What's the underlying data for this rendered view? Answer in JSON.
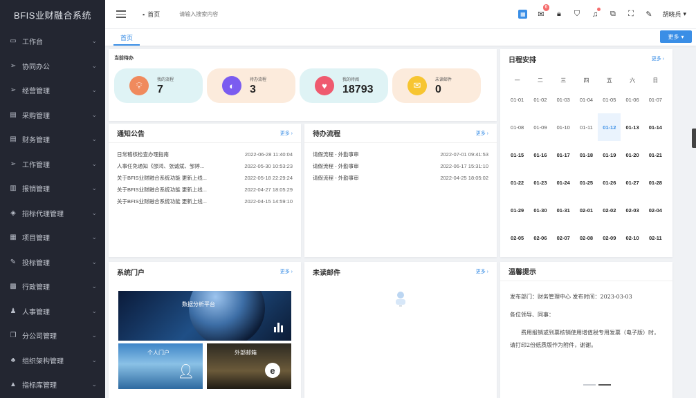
{
  "app": {
    "title": "BFIS业财融合系统"
  },
  "sidebar": {
    "items": [
      {
        "label": "工作台",
        "icon": "monitor-icon"
      },
      {
        "label": "协同办公",
        "icon": "send-icon"
      },
      {
        "label": "经营管理",
        "icon": "send-icon"
      },
      {
        "label": "采购管理",
        "icon": "document-icon"
      },
      {
        "label": "财务管理",
        "icon": "document-icon"
      },
      {
        "label": "工作管理",
        "icon": "send-icon"
      },
      {
        "label": "报销管理",
        "icon": "clipboard-icon"
      },
      {
        "label": "招标代理管理",
        "icon": "eye-icon"
      },
      {
        "label": "项目管理",
        "icon": "grid-icon"
      },
      {
        "label": "投标管理",
        "icon": "edit-icon"
      },
      {
        "label": "行政管理",
        "icon": "building-icon"
      },
      {
        "label": "人事管理",
        "icon": "user-icon"
      },
      {
        "label": "分公司管理",
        "icon": "copy-icon"
      },
      {
        "label": "组织架构管理",
        "icon": "org-icon"
      },
      {
        "label": "指标库管理",
        "icon": "warning-icon"
      }
    ]
  },
  "header": {
    "breadcrumb": "首页",
    "search_placeholder": "请输入搜索内容",
    "notification_badge": "6",
    "user": "胡晓兵"
  },
  "tabs": {
    "active": "首页",
    "more": "更多"
  },
  "todo": {
    "title": "当前待办",
    "stats": [
      {
        "label": "我的流程",
        "value": "7",
        "icon": "bulb-icon",
        "color": "#f08a5d",
        "bg": "#dff3f5"
      },
      {
        "label": "待办流程",
        "value": "3",
        "icon": "compass-icon",
        "color": "#7b5cf0",
        "bg": "#fcebdc"
      },
      {
        "label": "我的待阅",
        "value": "18793",
        "icon": "heart-icon",
        "color": "#ef5a6f",
        "bg": "#dff3f5"
      },
      {
        "label": "未读邮件",
        "value": "0",
        "icon": "mail-icon",
        "color": "#f7c531",
        "bg": "#fcebdc"
      }
    ]
  },
  "notice": {
    "title": "通知公告",
    "more": "更多 ›",
    "items": [
      {
        "text": "日常稽核检查办理指南",
        "date": "2022-06-28 11:40:04"
      },
      {
        "text": "人事任免通知《邵鸿、张诚斌、邹婷...",
        "date": "2022-05-30 10:53:23"
      },
      {
        "text": "关于BFIS业财融合系统功能 更新上线...",
        "date": "2022-05-18 22:29:24"
      },
      {
        "text": "关于BFIS业财融合系统功能 更新上线...",
        "date": "2022-04-27 18:05:29"
      },
      {
        "text": "关于BFIS业财融合系统功能 更新上线...",
        "date": "2022-04-15 14:59:10"
      }
    ]
  },
  "pending": {
    "title": "待办流程",
    "more": "更多 ›",
    "items": [
      {
        "text": "请假流程 - 外勤事审",
        "date": "2022-07-01 09:41:53"
      },
      {
        "text": "请假流程 - 外勤事审",
        "date": "2022-06-17 15:31:10"
      },
      {
        "text": "请假流程 - 外勤事审",
        "date": "2022-04-25 18:05:02"
      }
    ]
  },
  "schedule": {
    "title": "日程安排",
    "more": "更多 ›",
    "weekdays": [
      "一",
      "二",
      "三",
      "四",
      "五",
      "六",
      "日"
    ],
    "days": [
      "01-01",
      "01-02",
      "01-03",
      "01-04",
      "01-05",
      "01-06",
      "01-07",
      "01-08",
      "01-09",
      "01-10",
      "01-11",
      "01-12",
      "01-13",
      "01-14",
      "01-15",
      "01-16",
      "01-17",
      "01-18",
      "01-19",
      "01-20",
      "01-21",
      "01-22",
      "01-23",
      "01-24",
      "01-25",
      "01-26",
      "01-27",
      "01-28",
      "01-29",
      "01-30",
      "01-31",
      "02-01",
      "02-02",
      "02-03",
      "02-04",
      "02-05",
      "02-06",
      "02-07",
      "02-08",
      "02-09",
      "02-10",
      "02-11"
    ],
    "today": "01-12"
  },
  "portal": {
    "title": "系统门户",
    "more": "更多 ›",
    "tiles": [
      "数据分析平台",
      "个人门户",
      "外部邮箱"
    ]
  },
  "mail": {
    "title": "未读邮件",
    "more": "更多 ›"
  },
  "tip": {
    "title": "温馨提示",
    "line1": "发布部门：财务管理中心    发布时间：2023-03-03",
    "line2": "各位领导、同事：",
    "line3": "费用报销或到票核销使用增值税专用发票（电子版）时，请打印2份纸质版作为附件，谢谢。"
  }
}
